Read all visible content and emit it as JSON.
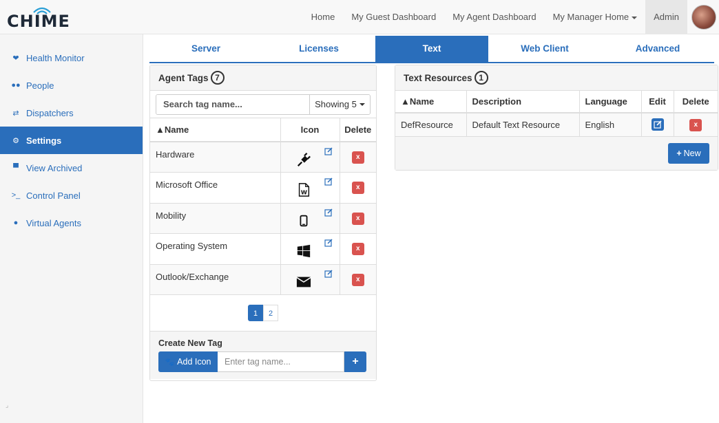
{
  "brand": {
    "logo_text": "CHIME"
  },
  "nav": {
    "links": [
      {
        "label": "Home"
      },
      {
        "label": "My Guest Dashboard"
      },
      {
        "label": "My Agent Dashboard"
      },
      {
        "label": "My Manager Home"
      },
      {
        "label": "Admin"
      }
    ]
  },
  "sidebar": {
    "items": [
      {
        "label": "Health Monitor",
        "icon": "heartbeat-icon"
      },
      {
        "label": "People",
        "icon": "users-icon"
      },
      {
        "label": "Dispatchers",
        "icon": "exchange-icon"
      },
      {
        "label": "Settings",
        "icon": "cogs-icon"
      },
      {
        "label": "View Archived",
        "icon": "archive-icon"
      },
      {
        "label": "Control Panel",
        "icon": "terminal-icon"
      },
      {
        "label": "Virtual Agents",
        "icon": "robot-icon"
      }
    ],
    "active_index": 3
  },
  "tabs": [
    {
      "label": "Server"
    },
    {
      "label": "Licenses"
    },
    {
      "label": "Text"
    },
    {
      "label": "Web Client"
    },
    {
      "label": "Advanced"
    }
  ],
  "active_tab": "Text",
  "agent_tags": {
    "title": "Agent Tags",
    "count": "7",
    "search_placeholder": "Search tag name...",
    "showing_label": "Showing 5",
    "columns": {
      "name": "▲Name",
      "icon": "Icon",
      "delete": "Delete"
    },
    "rows": [
      {
        "name": "Hardware",
        "icon": "plug-icon"
      },
      {
        "name": "Microsoft Office",
        "icon": "word-file-icon"
      },
      {
        "name": "Mobility",
        "icon": "mobile-icon"
      },
      {
        "name": "Operating System",
        "icon": "windows-icon"
      },
      {
        "name": "Outlook/Exchange",
        "icon": "envelope-icon"
      }
    ],
    "pages": [
      "1",
      "2"
    ],
    "current_page": "1",
    "create": {
      "label": "Create New Tag",
      "add_icon_label": "Add Icon",
      "input_placeholder": "Enter tag name...",
      "plus": "+"
    },
    "delete_glyph": "x"
  },
  "text_resources": {
    "title": "Text Resources",
    "count": "1",
    "columns": {
      "name": "▲Name",
      "description": "Description",
      "language": "Language",
      "edit": "Edit",
      "delete": "Delete"
    },
    "rows": [
      {
        "name": "DefResource",
        "description": "Default Text Resource",
        "language": "English"
      }
    ],
    "new_label": "New"
  },
  "colors": {
    "primary": "#2a6ebb",
    "danger": "#d9534f",
    "panel_bg": "#f5f5f5"
  }
}
